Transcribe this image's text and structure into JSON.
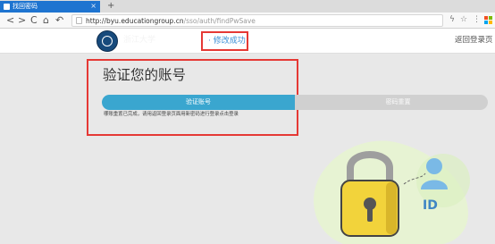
{
  "browser": {
    "tab_title": "找回密码",
    "tab_close": "×",
    "new_tab": "+",
    "back": "<",
    "forward": ">",
    "reload": "C",
    "home": "⌂",
    "undo": "↶",
    "url_host": "http://byu.educationgroup.cn",
    "url_path": "/sso/auth/findPwSave",
    "lightning_icon": "ϟ",
    "star_icon": "☆",
    "menu_icon": "⋮"
  },
  "header": {
    "logo_text": "浙江大学",
    "page_title": "· 修改成功",
    "back_link": "返回登录页"
  },
  "card": {
    "heading": "验证您的账号",
    "steps": [
      {
        "label": "验证账号",
        "state": "active"
      },
      {
        "label": "密码重置",
        "state": "inactive"
      }
    ],
    "notice": "哪账重置已完成，请用返回登录页面用新密码进行登录点击登录"
  },
  "illustration": {
    "badge_text": "ID"
  },
  "colors": {
    "accent": "#3aa6cf",
    "highlight_box": "#e53935",
    "tab_blue": "#1e74d0",
    "lock_yellow": "#f2d33b"
  }
}
